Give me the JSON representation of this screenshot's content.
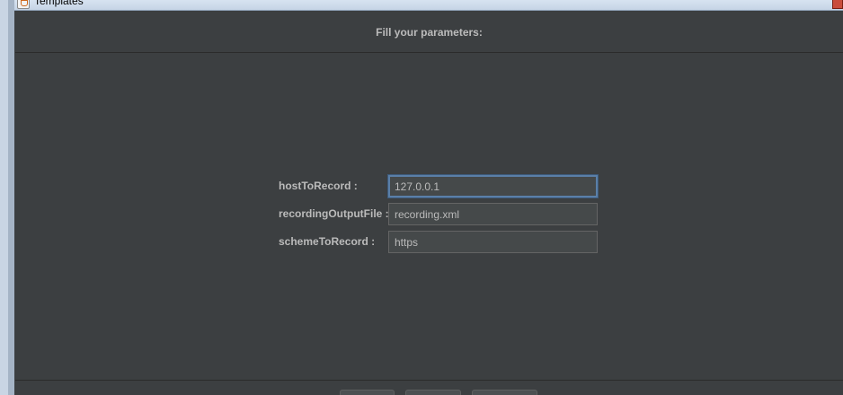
{
  "window": {
    "title": "Templates",
    "close_icon": "close-icon",
    "app_icon": "java-cup-icon"
  },
  "header": {
    "title": "Fill your parameters:"
  },
  "form": {
    "fields": [
      {
        "label": "hostToRecord :",
        "value": "127.0.0.1",
        "focused": true
      },
      {
        "label": "recordingOutputFile :",
        "value": "recording.xml",
        "focused": false
      },
      {
        "label": "schemeToRecord :",
        "value": "https",
        "focused": false
      }
    ]
  },
  "colors": {
    "background": "#3c3f41",
    "text": "#bbbbbb",
    "input_background": "#45494a",
    "focus_border": "#5a7fa8"
  }
}
